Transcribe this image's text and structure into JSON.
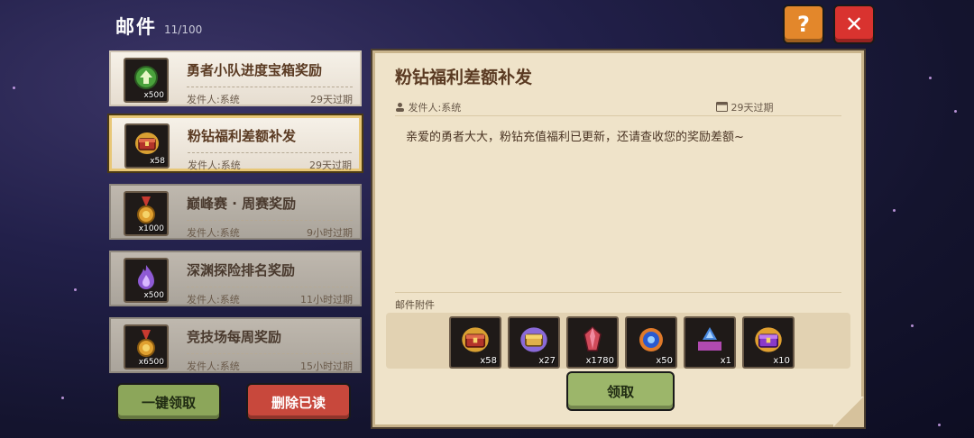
{
  "header": {
    "title": "邮件",
    "count": "11/100"
  },
  "buttons": {
    "help": "?",
    "close": "✕",
    "claim_all": "一键领取",
    "delete_read": "删除已读",
    "claim": "领取"
  },
  "mails": [
    {
      "title": "勇者小队进度宝箱奖励",
      "sender": "发件人:系统",
      "expire": "29天过期",
      "qty": "x500",
      "icon": "arrow-up-icon"
    },
    {
      "title": "粉钻福利差额补发",
      "sender": "发件人:系统",
      "expire": "29天过期",
      "qty": "x58",
      "icon": "treasure-chest-icon"
    },
    {
      "title": "巅峰赛 · 周赛奖励",
      "sender": "发件人:系统",
      "expire": "9小时过期",
      "qty": "x1000",
      "icon": "medal-icon"
    },
    {
      "title": "深渊探险排名奖励",
      "sender": "发件人:系统",
      "expire": "11小时过期",
      "qty": "x500",
      "icon": "purple-flame-icon"
    },
    {
      "title": "竞技场每周奖励",
      "sender": "发件人:系统",
      "expire": "15小时过期",
      "qty": "x6500",
      "icon": "medal-icon"
    }
  ],
  "detail": {
    "title": "粉钻福利差额补发",
    "sender": "发件人:系统",
    "expire": "29天过期",
    "body": "亲爱的勇者大大，粉钻充值福利已更新，还请查收您的奖励差额~",
    "attachments_label": "邮件附件",
    "attachments": [
      {
        "qty": "x58",
        "icon": "treasure-chest-icon"
      },
      {
        "qty": "x27",
        "icon": "purple-chest-icon"
      },
      {
        "qty": "x1780",
        "icon": "red-crystal-icon"
      },
      {
        "qty": "x50",
        "icon": "blue-orb-icon"
      },
      {
        "qty": "x1",
        "icon": "blue-crystal-shrine-icon"
      },
      {
        "qty": "x10",
        "icon": "purple-treasure-chest-icon"
      }
    ]
  }
}
